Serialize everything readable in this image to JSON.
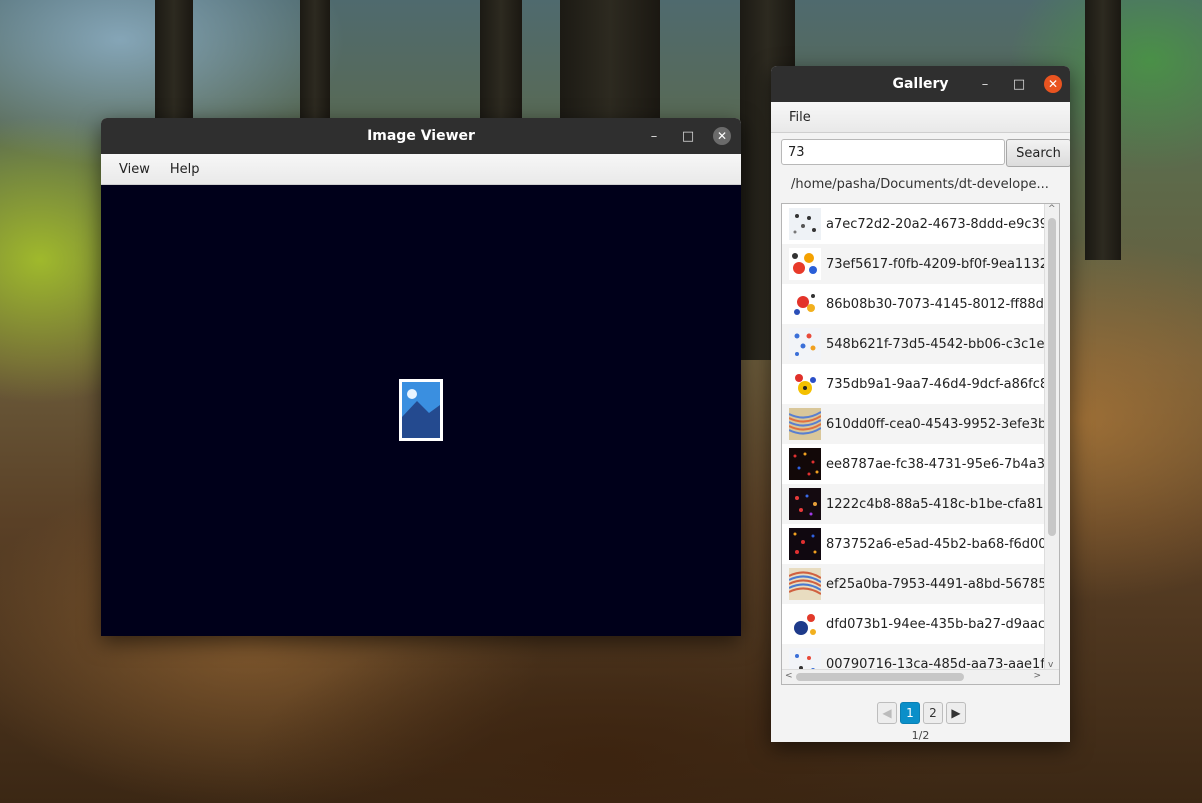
{
  "image_viewer": {
    "title": "Image Viewer",
    "menu": [
      "View",
      "Help"
    ]
  },
  "gallery": {
    "title": "Gallery",
    "menu": [
      "File"
    ],
    "search": {
      "value": "73",
      "button_label": "Search"
    },
    "path": "/home/pasha/Documents/dt-develope...",
    "items": [
      "a7ec72d2-20a2-4673-8ddd-e9c39",
      "73ef5617-f0fb-4209-bf0f-9ea1132",
      "86b08b30-7073-4145-8012-ff88d",
      "548b621f-73d5-4542-bb06-c3c1e",
      "735db9a1-9aa7-46d4-9dcf-a86fc8",
      "610dd0ff-cea0-4543-9952-3efe3b",
      "ee8787ae-fc38-4731-95e6-7b4a3",
      "1222c4b8-88a5-418c-b1be-cfa81",
      "873752a6-e5ad-45b2-ba68-f6d00",
      "ef25a0ba-7953-4491-a8bd-56785",
      "dfd073b1-94ee-435b-ba27-d9aac",
      "00790716-13ca-485d-aa73-aae1f"
    ],
    "pager": {
      "pages": [
        "1",
        "2"
      ],
      "current": "1",
      "info": "1/2"
    }
  },
  "window_controls": {
    "minimize": "–",
    "maximize": "□",
    "close": "✕"
  },
  "colors": {
    "viewer_background": "#00001a",
    "pager_active": "#0a8fc9",
    "close_button": "#e95420"
  }
}
